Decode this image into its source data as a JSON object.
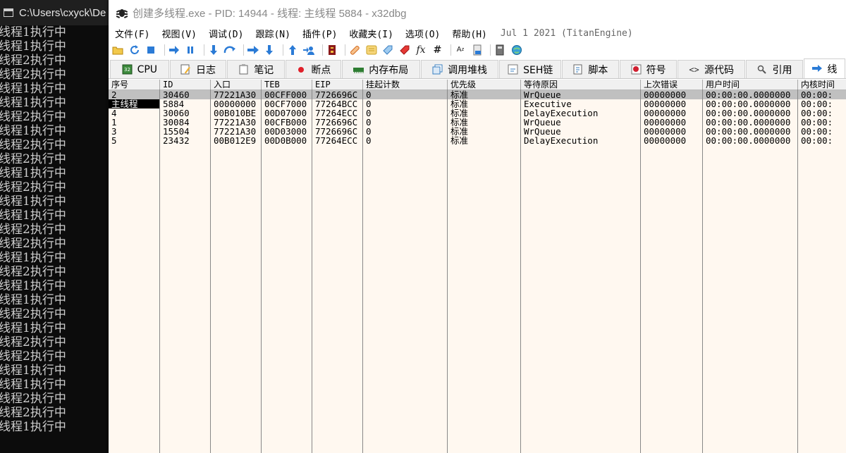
{
  "console": {
    "title": "C:\\Users\\cxyck\\De",
    "lines": [
      "线程1执行中",
      "线程1执行中",
      "线程2执行中",
      "线程2执行中",
      "线程1执行中",
      "线程1执行中",
      "线程2执行中",
      "线程1执行中",
      "线程2执行中",
      "线程2执行中",
      "线程1执行中",
      "线程2执行中",
      "线程1执行中",
      "线程1执行中",
      "线程2执行中",
      "线程2执行中",
      "线程1执行中",
      "线程2执行中",
      "线程1执行中",
      "线程1执行中",
      "线程2执行中",
      "线程1执行中",
      "线程2执行中",
      "线程2执行中",
      "线程1执行中",
      "线程1执行中",
      "线程2执行中",
      "线程2执行中",
      "线程1执行中"
    ]
  },
  "window": {
    "title": "创建多线程.exe - PID: 14944 - 线程: 主线程 5884 - x32dbg"
  },
  "menu": {
    "items": [
      "文件(F)",
      "视图(V)",
      "调试(D)",
      "跟踪(N)",
      "插件(P)",
      "收藏夹(I)",
      "选项(O)",
      "帮助(H)"
    ],
    "extra": "Jul 1 2021 (TitanEngine)"
  },
  "toolbar": {
    "icons": [
      "open-icon",
      "restart-icon",
      "stop-icon",
      "run-icon",
      "pause-icon",
      "step-into-icon",
      "step-over-icon",
      "trace-into-icon",
      "trace-over-icon",
      "execute-till-return-icon",
      "run-to-user-code-icon",
      "scylla-icon",
      "patches-icon",
      "comments-icon",
      "labels-icon",
      "bookmarks-icon",
      "functions-icon",
      "variables-icon",
      "strings-icon",
      "calculator-icon",
      "help-icon"
    ]
  },
  "tabs": [
    {
      "label": "CPU",
      "icon": "cpu-icon"
    },
    {
      "label": "日志",
      "icon": "log-icon"
    },
    {
      "label": "笔记",
      "icon": "notes-icon"
    },
    {
      "label": "断点",
      "icon": "breakpoint-icon"
    },
    {
      "label": "内存布局",
      "icon": "memory-map-icon"
    },
    {
      "label": "调用堆栈",
      "icon": "call-stack-icon"
    },
    {
      "label": "SEH链",
      "icon": "seh-icon"
    },
    {
      "label": "脚本",
      "icon": "script-icon"
    },
    {
      "label": "符号",
      "icon": "symbols-icon"
    },
    {
      "label": "源代码",
      "icon": "source-icon"
    },
    {
      "label": "引用",
      "icon": "references-icon"
    },
    {
      "label": "线",
      "icon": "threads-icon"
    }
  ],
  "threads": {
    "columns": [
      "序号",
      "ID",
      "入口",
      "TEB",
      "EIP",
      "挂起计数",
      "优先级",
      "等待原因",
      "上次错误",
      "用户时间",
      "内核时间"
    ],
    "rows": [
      [
        "2",
        "30460",
        "77221A30",
        "00CFF000",
        "7726696C",
        "0",
        "标准",
        "WrQueue",
        "00000000",
        "00:00:00.0000000",
        "00:00:"
      ],
      [
        "主线程",
        "5884",
        "00000000",
        "00CF7000",
        "77264BCC",
        "0",
        "标准",
        "Executive",
        "00000000",
        "00:00:00.0000000",
        "00:00:"
      ],
      [
        "4",
        "30060",
        "00B010BE",
        "00D07000",
        "77264ECC",
        "0",
        "标准",
        "DelayExecution",
        "00000000",
        "00:00:00.0000000",
        "00:00:"
      ],
      [
        "1",
        "30084",
        "77221A30",
        "00CFB000",
        "7726696C",
        "0",
        "标准",
        "WrQueue",
        "00000000",
        "00:00:00.0000000",
        "00:00:"
      ],
      [
        "3",
        "15504",
        "77221A30",
        "00D03000",
        "7726696C",
        "0",
        "标准",
        "WrQueue",
        "00000000",
        "00:00:00.0000000",
        "00:00:"
      ],
      [
        "5",
        "23432",
        "00B012E9",
        "00D0B000",
        "77264ECC",
        "0",
        "标准",
        "DelayExecution",
        "00000000",
        "00:00:00.0000000",
        "00:00:"
      ]
    ],
    "selected_row": 0,
    "highlighted_cell": "主线程"
  }
}
